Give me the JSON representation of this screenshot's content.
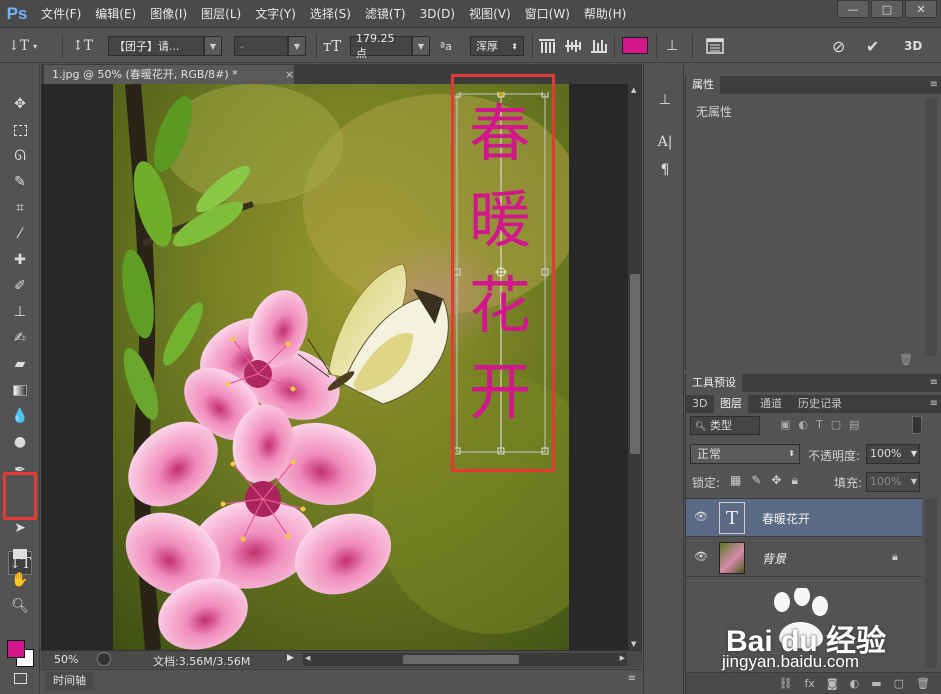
{
  "app": {
    "logo": "Ps"
  },
  "menu": {
    "items": [
      "文件(F)",
      "编辑(E)",
      "图像(I)",
      "图层(L)",
      "文字(Y)",
      "选择(S)",
      "滤镜(T)",
      "3D(D)",
      "视图(V)",
      "窗口(W)",
      "帮助(H)"
    ]
  },
  "window_controls": {
    "minimize": "—",
    "maximize": "□",
    "close": "✕"
  },
  "options_bar": {
    "font_family": "【团子】请...",
    "font_style": "-",
    "font_size": "179.25 点",
    "antialias_icon": "ªa",
    "antialias": "浑厚",
    "text_color": "#d2168c",
    "commit_label": "3D"
  },
  "document": {
    "tab_title": "1.jpg @ 50% (春暖花开, RGB/8#) *",
    "tab_close": "×",
    "text_content": [
      "春",
      "暖",
      "花",
      "开"
    ],
    "text_color": "#d2168c"
  },
  "status_bar": {
    "zoom": "50%",
    "doc_info": "文档:3.56M/3.56M"
  },
  "timeline": {
    "tab_label": "时间轴"
  },
  "properties_panel": {
    "tab_label": "属性",
    "body_text": "无属性"
  },
  "tool_presets_panel": {
    "tab_label": "工具预设"
  },
  "layers_panel": {
    "tabs": [
      "3D",
      "图层",
      "通道",
      "历史记录"
    ],
    "active_tab": "图层",
    "filter_kind": "类型",
    "blend_mode": "正常",
    "opacity_label": "不透明度:",
    "opacity_value": "100%",
    "lock_label": "锁定:",
    "fill_label": "填充:",
    "fill_value": "100%",
    "layers": [
      {
        "name": "春暖花开",
        "type": "text",
        "selected": true
      },
      {
        "name": "背景",
        "type": "image",
        "selected": false,
        "locked": true
      }
    ]
  },
  "watermark": {
    "brand": "Bai du 经验",
    "url": "jingyan.baidu.com"
  },
  "colors": {
    "foreground": "#d2168c",
    "background": "#ffffff",
    "highlight_red": "#e53935",
    "selected_layer": "#5a6a85"
  }
}
